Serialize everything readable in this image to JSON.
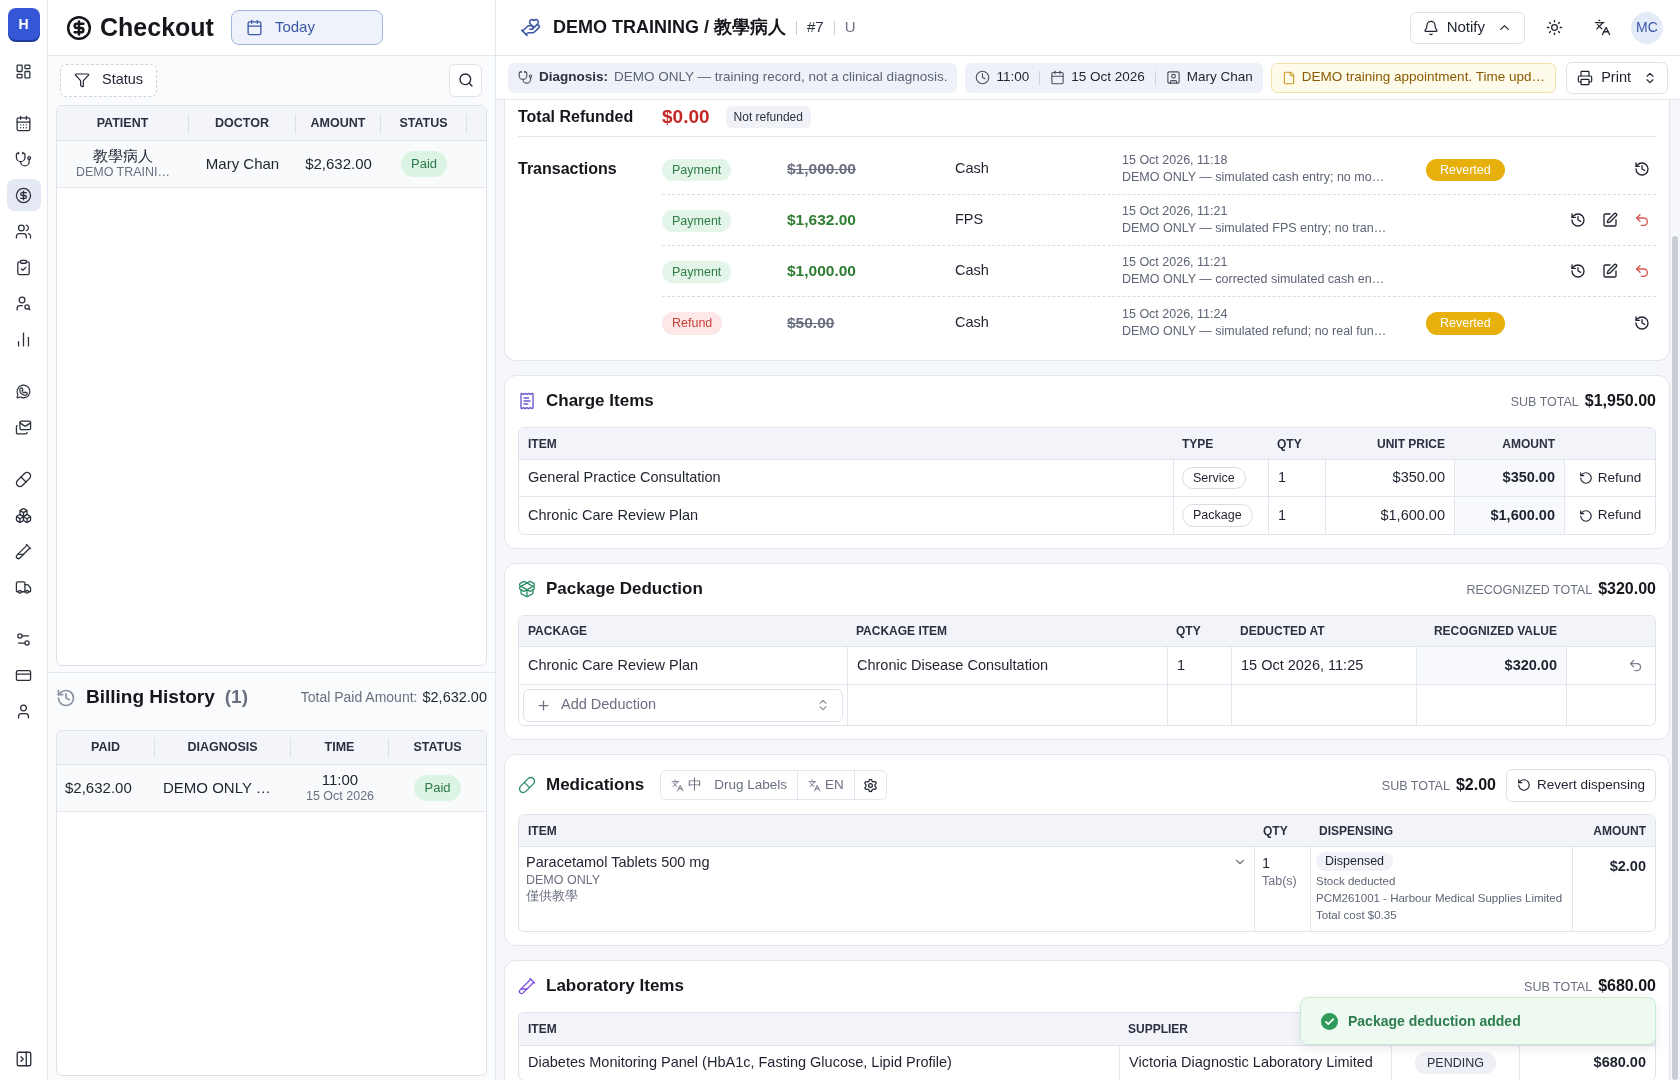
{
  "sidebar": {
    "logo": "H",
    "groups": [
      [
        {
          "selected": false
        }
      ],
      [
        {
          "selected": false
        },
        {
          "selected": false
        },
        {
          "selected": true
        },
        {
          "selected": false
        },
        {
          "selected": false
        },
        {
          "selected": false
        },
        {
          "selected": false
        }
      ],
      [
        {
          "selected": false
        },
        {
          "selected": false
        }
      ],
      [
        {
          "selected": false
        },
        {
          "selected": false
        },
        {
          "selected": false
        },
        {
          "selected": false
        }
      ],
      [
        {
          "selected": false
        },
        {
          "selected": false
        },
        {
          "selected": false
        }
      ]
    ]
  },
  "checkout": {
    "title": "Checkout",
    "date_button": "Today",
    "filter_button": "Status",
    "columns": [
      "PATIENT",
      "DOCTOR",
      "AMOUNT",
      "STATUS"
    ],
    "rows": [
      {
        "patient": "教學病人",
        "patient_note": "DEMO TRAINI…",
        "doctor": "Mary Chan",
        "amount": "$2,632.00",
        "status": "Paid"
      }
    ]
  },
  "billing_history": {
    "title": "Billing History",
    "count": "(1)",
    "total_label": "Total Paid Amount:",
    "total": "$2,632.00",
    "columns": [
      "PAID",
      "DIAGNOSIS",
      "TIME",
      "STATUS"
    ],
    "rows": [
      {
        "paid": "$2,632.00",
        "diagnosis": "DEMO ONLY …",
        "time": "11:00",
        "date": "15 Oct 2026",
        "status": "Paid"
      }
    ]
  },
  "header": {
    "title": "DEMO TRAINING / 教學病人",
    "number": "#7",
    "tag": "U",
    "notify_button": "Notify",
    "avatar": "MC"
  },
  "info_bar": {
    "diagnosis_label": "Diagnosis:",
    "diagnosis": "DEMO ONLY — training record, not a clinical diagnosis.",
    "time": "11:00",
    "date": "15 Oct 2026",
    "doctor": "Mary Chan",
    "note": "DEMO training appointment. Time upd…",
    "print_button": "Print"
  },
  "payments": {
    "refunded_label": "Total Refunded",
    "refunded_total": "$0.00",
    "refund_state": "Not refunded",
    "transactions_label": "Transactions",
    "transactions": [
      {
        "kind": "payment",
        "type": "Payment",
        "amount": "$1,000.00",
        "reverted": true,
        "method": "Cash",
        "time": "15 Oct 2026, 11:18",
        "note": "DEMO ONLY — simulated cash entry; no mo…",
        "status": "Reverted"
      },
      {
        "kind": "payment",
        "type": "Payment",
        "amount": "$1,632.00",
        "reverted": false,
        "method": "FPS",
        "time": "15 Oct 2026, 11:21",
        "note": "DEMO ONLY — simulated FPS entry; no tran…"
      },
      {
        "kind": "payment",
        "type": "Payment",
        "amount": "$1,000.00",
        "reverted": false,
        "method": "Cash",
        "time": "15 Oct 2026, 11:21",
        "note": "DEMO ONLY — corrected simulated cash en…"
      },
      {
        "kind": "refund",
        "type": "Refund",
        "amount": "$50.00",
        "reverted": true,
        "method": "Cash",
        "time": "15 Oct 2026, 11:24",
        "note": "DEMO ONLY — simulated refund; no real fun…",
        "status": "Reverted"
      }
    ]
  },
  "charge_items": {
    "title": "Charge Items",
    "subtotal_label": "SUB TOTAL",
    "subtotal": "$1,950.00",
    "columns": [
      "ITEM",
      "TYPE",
      "QTY",
      "UNIT PRICE",
      "AMOUNT"
    ],
    "rows": [
      {
        "item": "General Practice Consultation",
        "type": "Service",
        "qty": "1",
        "unit_price": "$350.00",
        "amount": "$350.00",
        "action": "Refund"
      },
      {
        "item": "Chronic Care Review Plan",
        "type": "Package",
        "qty": "1",
        "unit_price": "$1,600.00",
        "amount": "$1,600.00",
        "action": "Refund"
      }
    ]
  },
  "package_deduction": {
    "title": "Package Deduction",
    "total_label": "RECOGNIZED TOTAL",
    "total": "$320.00",
    "columns": [
      "PACKAGE",
      "PACKAGE ITEM",
      "QTY",
      "DEDUCTED AT",
      "RECOGNIZED VALUE"
    ],
    "rows": [
      {
        "package": "Chronic Care Review Plan",
        "item": "Chronic Disease Consultation",
        "qty": "1",
        "deducted_at": "15 Oct 2026, 11:25",
        "value": "$320.00"
      }
    ],
    "add_placeholder": "Add Deduction"
  },
  "medications": {
    "title": "Medications",
    "label_buttons": [
      {
        "lang": "中",
        "label": "Drug Labels"
      },
      {
        "lang": "EN"
      }
    ],
    "subtotal_label": "SUB TOTAL",
    "subtotal": "$2.00",
    "revert_button": "Revert dispensing",
    "columns": [
      "ITEM",
      "QTY",
      "DISPENSING",
      "AMOUNT"
    ],
    "rows": [
      {
        "name": "Paracetamol Tablets 500 mg",
        "notes": [
          "DEMO ONLY",
          "僅供教學"
        ],
        "qty": "1",
        "unit": "Tab(s)",
        "status": "Dispensed",
        "details": [
          "Stock deducted",
          "PCM261001 - Harbour Medical Supplies Limited",
          "Total cost $0.35"
        ],
        "amount": "$2.00"
      }
    ]
  },
  "laboratory_items": {
    "title": "Laboratory Items",
    "subtotal_label": "SUB TOTAL",
    "subtotal": "$680.00",
    "columns": [
      "ITEM",
      "SUPPLIER"
    ],
    "rows": [
      {
        "item": "Diabetes Monitoring Panel (HbA1c, Fasting Glucose, Lipid Profile)",
        "supplier": "Victoria Diagnostic Laboratory Limited",
        "status": "PENDING",
        "amount": "$680.00"
      }
    ]
  },
  "toast": {
    "message": "Package deduction added"
  }
}
